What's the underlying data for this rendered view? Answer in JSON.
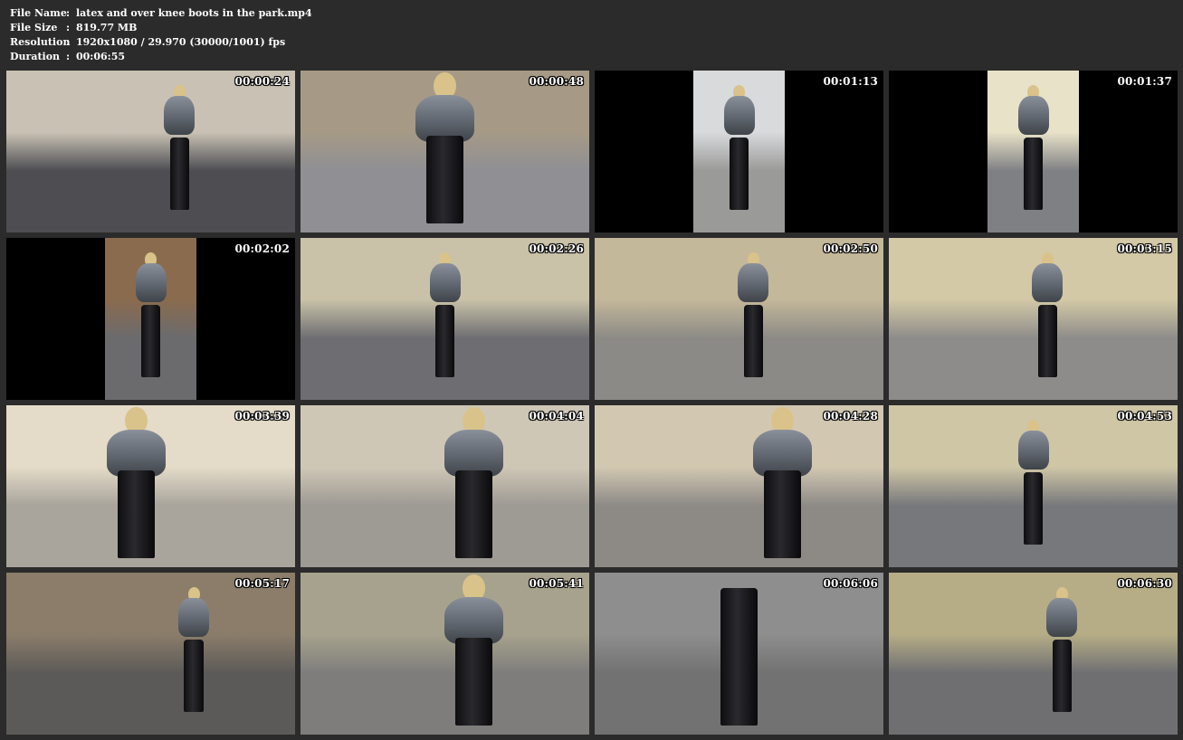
{
  "info": {
    "rows": [
      {
        "key": "File Name",
        "sep": ":",
        "value": "latex and over knee boots in the park.mp4"
      },
      {
        "key": "File Size",
        "sep": ":",
        "value": "819.77 MB"
      },
      {
        "key": "Resolution",
        "sep": ":",
        "value": "1920x1080 / 29.970 (30000/1001) fps"
      },
      {
        "key": "Duration",
        "sep": ":",
        "value": "00:06:55"
      }
    ]
  },
  "thumbnails": [
    {
      "timecode": "00:00:24",
      "scene": "park-path",
      "layout": "full",
      "colors": {
        "top": "#c9c2b4",
        "bottom": "#4d4d52"
      }
    },
    {
      "timecode": "00:00:48",
      "scene": "stone-stairs",
      "layout": "full",
      "colors": {
        "top": "#a69a86",
        "bottom": "#8f8f94"
      }
    },
    {
      "timecode": "00:01:13",
      "scene": "balustrade-vertical",
      "layout": "pillarbox",
      "colors": {
        "top": "#d8dadc",
        "bottom": "#9a9a98"
      }
    },
    {
      "timecode": "00:01:37",
      "scene": "stairs-vertical",
      "layout": "pillarbox",
      "colors": {
        "top": "#e8e2c8",
        "bottom": "#7f8084"
      }
    },
    {
      "timecode": "00:02:02",
      "scene": "doorway-vertical",
      "layout": "pillarbox",
      "colors": {
        "top": "#8a6b4e",
        "bottom": "#6b6b6e"
      }
    },
    {
      "timecode": "00:02:26",
      "scene": "colonnade",
      "layout": "full",
      "colors": {
        "top": "#c9c2a8",
        "bottom": "#6e6e72"
      }
    },
    {
      "timecode": "00:02:50",
      "scene": "columns-graffiti",
      "layout": "full",
      "colors": {
        "top": "#c4b89a",
        "bottom": "#8c8a86"
      }
    },
    {
      "timecode": "00:03:15",
      "scene": "terrace",
      "layout": "full",
      "colors": {
        "top": "#d3c9a6",
        "bottom": "#8e8c8a"
      }
    },
    {
      "timecode": "00:03:39",
      "scene": "balcony-closeup",
      "layout": "full",
      "colors": {
        "top": "#e4dcc8",
        "bottom": "#a9a49c"
      }
    },
    {
      "timecode": "00:04:04",
      "scene": "balustrade-rear",
      "layout": "full",
      "colors": {
        "top": "#cfc7b6",
        "bottom": "#9e9a94"
      }
    },
    {
      "timecode": "00:04:28",
      "scene": "balustrade-side",
      "layout": "full",
      "colors": {
        "top": "#d2c8b2",
        "bottom": "#8d8a86"
      }
    },
    {
      "timecode": "00:04:53",
      "scene": "courtyard",
      "layout": "full",
      "colors": {
        "top": "#cfc6a6",
        "bottom": "#77787c"
      }
    },
    {
      "timecode": "00:05:17",
      "scene": "street-cars",
      "layout": "full",
      "colors": {
        "top": "#8b7d6a",
        "bottom": "#5c5a58"
      }
    },
    {
      "timecode": "00:05:41",
      "scene": "alley-rear",
      "layout": "full",
      "colors": {
        "top": "#a7a28d",
        "bottom": "#7e7d7c"
      }
    },
    {
      "timecode": "00:06:06",
      "scene": "pov-boots",
      "layout": "full",
      "colors": {
        "top": "#8e8e8e",
        "bottom": "#727272"
      }
    },
    {
      "timecode": "00:06:30",
      "scene": "sidewalk-rear",
      "layout": "full",
      "colors": {
        "top": "#b6ad86",
        "bottom": "#6f6f72"
      }
    }
  ]
}
